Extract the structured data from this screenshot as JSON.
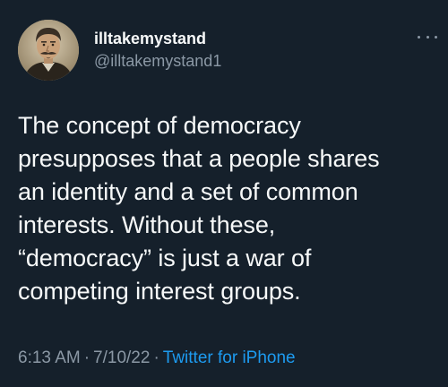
{
  "user": {
    "display_name": "illtakemystand",
    "handle": "@illtakemystand1",
    "avatar_icon": "portrait-avatar-icon"
  },
  "tweet": {
    "lines": [
      "The concept of democracy",
      "presupposes that a people shares",
      "an identity and a set of common",
      "interests. Without these,",
      "“democracy” is just a war of",
      "competing interest groups."
    ],
    "time": "6:13 AM",
    "date": "7/10/22",
    "separator": "·",
    "source": "Twitter for iPhone"
  },
  "menu": {
    "icon": "more-horizontal-icon"
  },
  "colors": {
    "background": "#15202b",
    "primary_text": "#f7f9f9",
    "secondary_text": "#8b98a5",
    "link": "#1d9bf0"
  }
}
